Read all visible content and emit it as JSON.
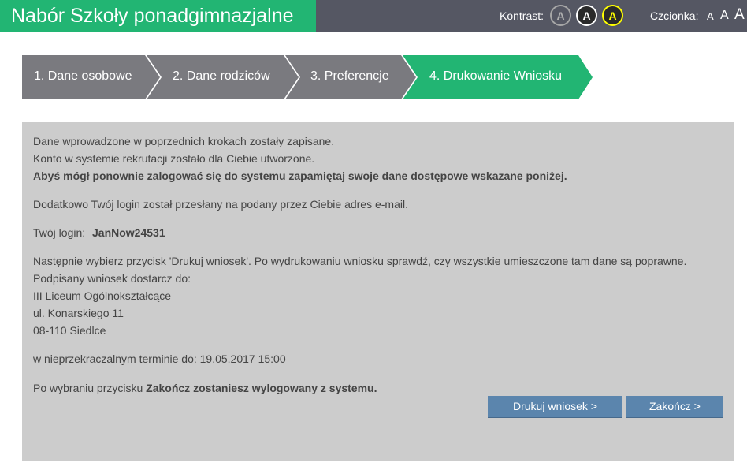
{
  "header": {
    "title": "Nabór Szkoły ponadgimnazjalne",
    "contrast_label": "Kontrast:",
    "contrast_options": [
      "A",
      "A",
      "A"
    ],
    "font_label": "Czcionka:",
    "font_sizes": [
      "A",
      "A",
      "A"
    ],
    "colors": {
      "brand": "#22b573",
      "bar": "#555763"
    }
  },
  "steps": [
    {
      "label": "1. Dane osobowe",
      "state": "done"
    },
    {
      "label": "2. Dane rodziców",
      "state": "done"
    },
    {
      "label": "3. Preferencje",
      "state": "done"
    },
    {
      "label": "4. Drukowanie Wniosku",
      "state": "active"
    }
  ],
  "content": {
    "line1": "Dane wprowadzone w poprzednich krokach zostały zapisane.",
    "line2": "Konto w systemie rekrutacji zostało dla Ciebie utworzone.",
    "line3": "Abyś mógł ponownie zalogować się do systemu zapamiętaj swoje dane dostępowe wskazane poniżej.",
    "email_note": "Dodatkowo Twój login został przesłany na podany przez Ciebie adres e-mail.",
    "login_label": "Twój login:",
    "login_value": "JanNow24531",
    "instruction": "Następnie wybierz przycisk 'Drukuj wniosek'. Po wydrukowaniu wniosku sprawdź, czy wszystkie umieszczone tam dane są poprawne.",
    "deliver_to": "Podpisany wniosek dostarcz do:",
    "school_name": "III Liceum Ogólnokształcące",
    "school_street": "ul. Konarskiego 11",
    "school_city": "08-110 Siedlce",
    "deadline": "w nieprzekraczalnym terminie do: 19.05.2017 15:00",
    "logout_prefix": "Po wybraniu przycisku",
    "logout_bold": "Zakończ zostaniesz wylogowany z systemu."
  },
  "buttons": {
    "print": "Drukuj wniosek >",
    "finish": "Zakończ >"
  }
}
